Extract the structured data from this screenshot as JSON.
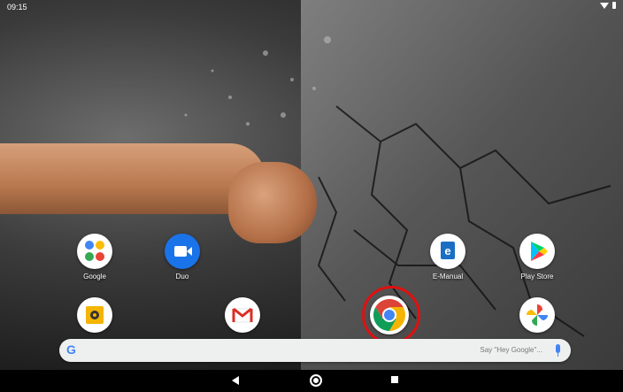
{
  "status": {
    "time": "09:15"
  },
  "apps": {
    "google": {
      "label": "Google",
      "icon": "google-folder-icon"
    },
    "duo": {
      "label": "Duo",
      "icon": "duo-icon"
    },
    "emanual": {
      "label": "E-Manual",
      "icon": "emanual-icon"
    },
    "playstore": {
      "label": "Play Store",
      "icon": "play-store-icon"
    },
    "slides": {
      "label": "",
      "icon": "slides-icon"
    },
    "gmail": {
      "label": "",
      "icon": "gmail-icon"
    },
    "chrome": {
      "label": "",
      "icon": "chrome-icon"
    },
    "photos": {
      "label": "",
      "icon": "photos-icon"
    }
  },
  "search": {
    "hint": "Say \"Hey Google\"...",
    "logo": "G"
  },
  "colors": {
    "highlight": "#e01010",
    "nav_bg": "#000000",
    "search_bg": "#eef0f0"
  }
}
